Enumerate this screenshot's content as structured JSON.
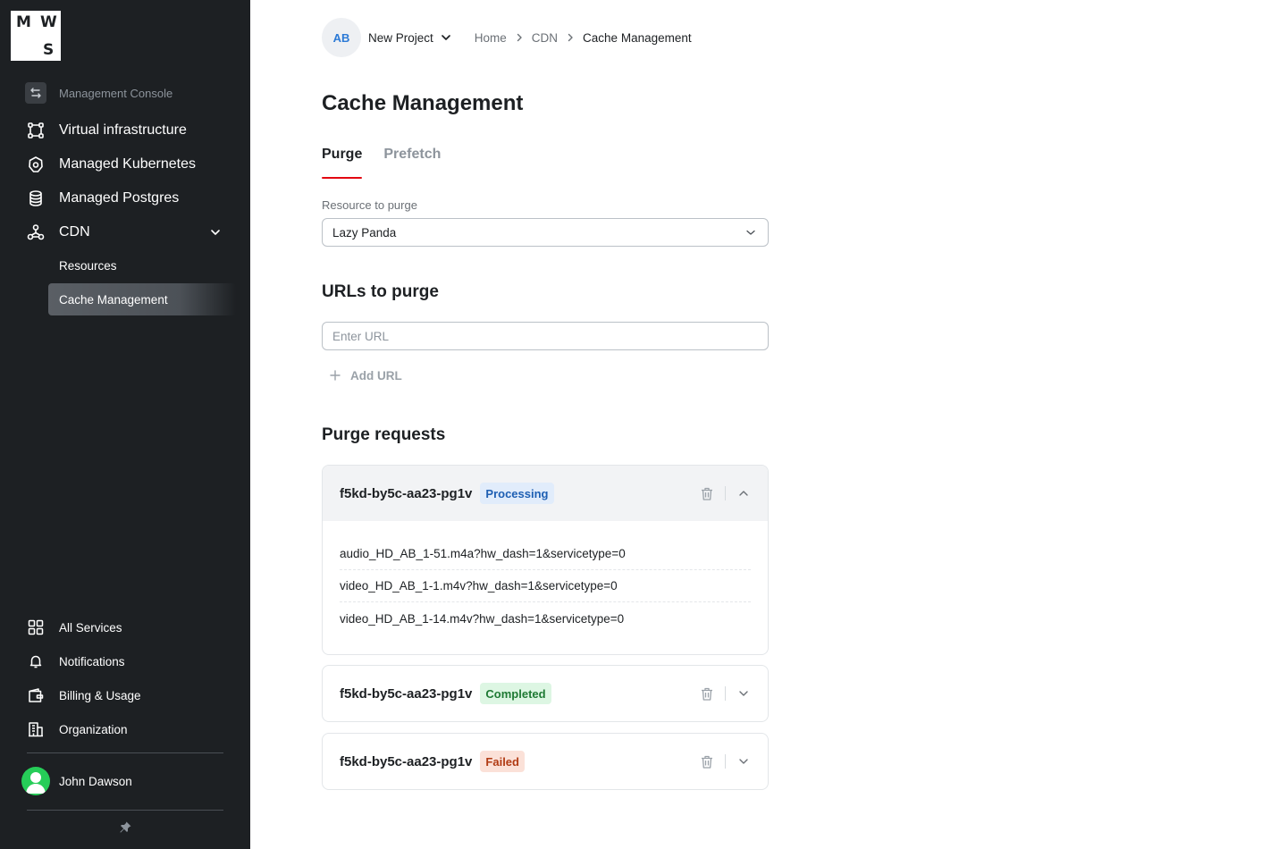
{
  "sidebar": {
    "logo": {
      "l1": "M",
      "l2": "W",
      "l3": "S"
    },
    "console_label": "Management Console",
    "items": [
      {
        "label": "Virtual infrastructure",
        "icon": "nodes-icon"
      },
      {
        "label": "Managed Kubernetes",
        "icon": "kubernetes-icon"
      },
      {
        "label": "Managed Postgres",
        "icon": "database-icon"
      },
      {
        "label": "CDN",
        "icon": "cdn-icon"
      }
    ],
    "cdn_sub": [
      {
        "label": "Resources"
      },
      {
        "label": "Cache Management"
      }
    ],
    "bottom": [
      {
        "label": "All Services",
        "icon": "grid-icon"
      },
      {
        "label": "Notifications",
        "icon": "bell-icon"
      },
      {
        "label": "Billing & Usage",
        "icon": "wallet-icon"
      },
      {
        "label": "Organization",
        "icon": "building-icon"
      }
    ],
    "user": {
      "name": "John Dawson"
    }
  },
  "header": {
    "project_initials": "AB",
    "project_name": "New Project",
    "breadcrumbs": [
      "Home",
      "CDN",
      "Cache Management"
    ]
  },
  "page": {
    "title": "Cache Management",
    "tabs": [
      "Purge",
      "Prefetch"
    ],
    "resource_label": "Resource to purge",
    "resource_value": "Lazy Panda",
    "urls_title": "URLs to purge",
    "url_placeholder": "Enter URL",
    "add_url_label": "Add URL",
    "requests_title": "Purge requests"
  },
  "requests": [
    {
      "id": "f5kd-by5c-aa23-pg1v",
      "status": "Processing",
      "urls": [
        "audio_HD_AB_1-51.m4a?hw_dash=1&servicetype=0",
        "video_HD_AB_1-1.m4v?hw_dash=1&servicetype=0",
        "video_HD_AB_1-14.m4v?hw_dash=1&servicetype=0"
      ]
    },
    {
      "id": "f5kd-by5c-aa23-pg1v",
      "status": "Completed"
    },
    {
      "id": "f5kd-by5c-aa23-pg1v",
      "status": "Failed"
    }
  ],
  "colors": {
    "sidebar_bg": "#1d2023",
    "accent_red": "#e30611",
    "processing": "#1e5fb3",
    "completed": "#1f7a34",
    "failed": "#b13b14"
  }
}
